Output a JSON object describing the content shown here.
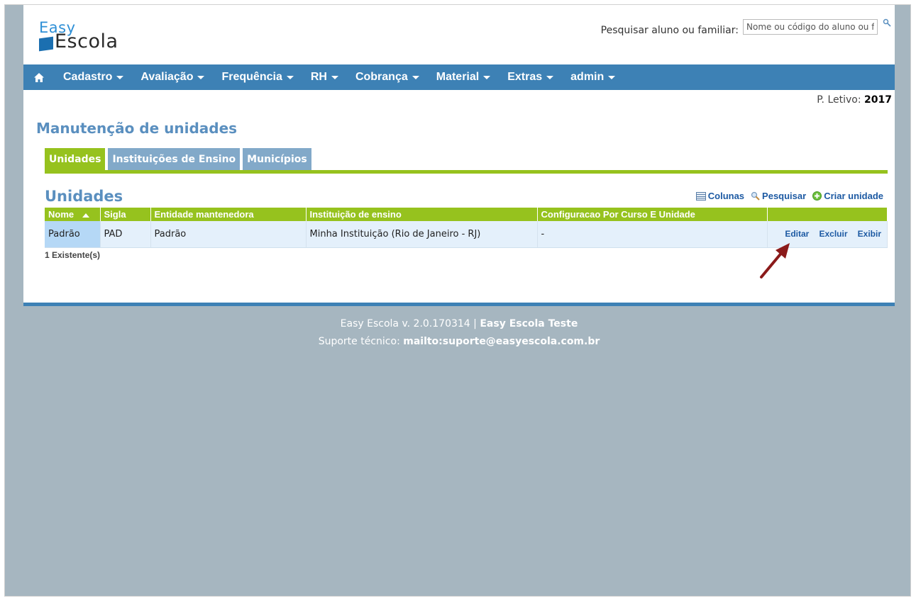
{
  "logo": {
    "line1": "Easy",
    "line2": "Escola"
  },
  "search": {
    "label": "Pesquisar aluno ou familiar:",
    "placeholder": "Nome ou código do aluno ou familiar"
  },
  "nav": {
    "items": [
      {
        "label": "Cadastro"
      },
      {
        "label": "Avaliação"
      },
      {
        "label": "Frequência"
      },
      {
        "label": "RH"
      },
      {
        "label": "Cobrança"
      },
      {
        "label": "Material"
      },
      {
        "label": "Extras"
      },
      {
        "label": "admin"
      }
    ]
  },
  "periodo": {
    "label": "P. Letivo:",
    "value": "2017"
  },
  "page_title": "Manutenção de unidades",
  "tabs": [
    {
      "label": "Unidades",
      "active": true
    },
    {
      "label": "Instituições de Ensino",
      "active": false
    },
    {
      "label": "Municípios",
      "active": false
    }
  ],
  "section_title": "Unidades",
  "toolbar": {
    "columns": "Colunas",
    "search": "Pesquisar",
    "create": "Criar unidade"
  },
  "table": {
    "headers": [
      "Nome",
      "Sigla",
      "Entidade mantenedora",
      "Instituição de ensino",
      "Configuracao Por Curso E Unidade"
    ],
    "rows": [
      {
        "cells": [
          "Padrão",
          "PAD",
          "Padrão",
          "Minha Instituição (Rio de Janeiro - RJ)",
          "-"
        ],
        "actions": [
          "Editar",
          "Excluir",
          "Exibir"
        ]
      }
    ]
  },
  "count": "1 Existente(s)",
  "footer": {
    "version": "Easy Escola v. 2.0.170314",
    "separator": "|",
    "env": "Easy Escola Teste",
    "support_label": "Suporte técnico:",
    "support_link": "mailto:suporte@easyescola.com.br"
  },
  "colors": {
    "nav": "#3d81b5",
    "accent_green": "#96c21e",
    "title_blue": "#5a8fbf",
    "background": "#a6b6c0",
    "annotation_arrow": "#8b1a1a"
  }
}
